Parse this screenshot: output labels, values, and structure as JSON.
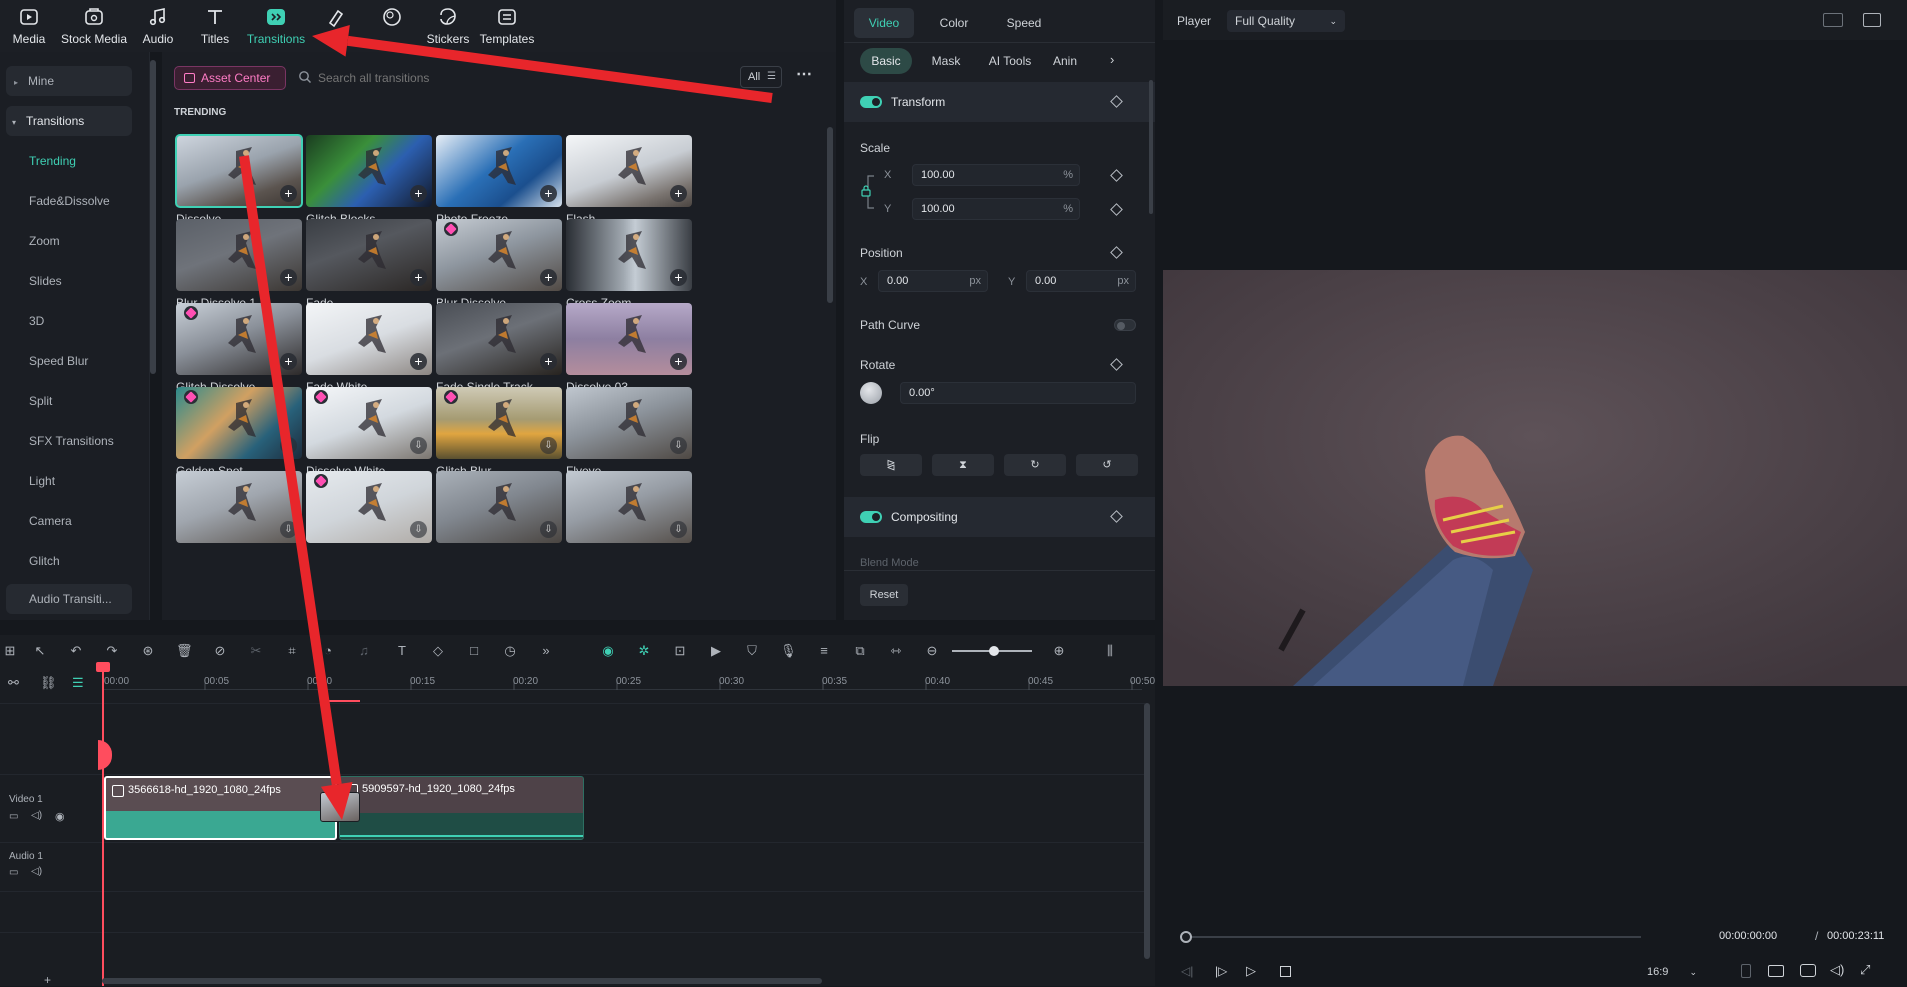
{
  "toolbar": {
    "items": [
      {
        "label": "Media",
        "icon": "media-icon"
      },
      {
        "label": "Stock Media",
        "icon": "stock-media-icon"
      },
      {
        "label": "Audio",
        "icon": "music-note-icon"
      },
      {
        "label": "Titles",
        "icon": "title-t-icon"
      },
      {
        "label": "Transitions",
        "icon": "transitions-icon",
        "active": true
      },
      {
        "label": "Effects",
        "icon": "effects-icon"
      },
      {
        "label": "Filters",
        "icon": "filters-icon"
      },
      {
        "label": "Stickers",
        "icon": "sticker-icon"
      },
      {
        "label": "Templates",
        "icon": "templates-icon"
      }
    ]
  },
  "leftnav": {
    "mine": "Mine",
    "transitions": "Transitions",
    "items": [
      "Trending",
      "Fade&Dissolve",
      "Zoom",
      "Slides",
      "3D",
      "Speed Blur",
      "Split",
      "SFX Transitions",
      "Light",
      "Camera",
      "Glitch",
      "Audio Transiti..."
    ]
  },
  "content": {
    "asset_center": "Asset Center",
    "search_placeholder": "Search all transitions",
    "filter": "All",
    "section": "TRENDING",
    "cards": [
      {
        "label": "Dissolve",
        "badge": "plus",
        "premium": false
      },
      {
        "label": "Glitch Blocks",
        "badge": "plus",
        "premium": false
      },
      {
        "label": "Photo Freeze",
        "badge": "plus",
        "premium": false
      },
      {
        "label": "Flash",
        "badge": "plus",
        "premium": false
      },
      {
        "label": "Blur Dissolve 1",
        "badge": "plus",
        "premium": false
      },
      {
        "label": "Fade",
        "badge": "plus",
        "premium": false
      },
      {
        "label": "Blur Dissolve",
        "badge": "plus",
        "premium": true
      },
      {
        "label": "Cross Zoom",
        "badge": "plus",
        "premium": false
      },
      {
        "label": "Glitch Dissolve",
        "badge": "plus",
        "premium": true
      },
      {
        "label": "Fade White",
        "badge": "plus",
        "premium": false
      },
      {
        "label": "Fade Single Track",
        "badge": "plus",
        "premium": false
      },
      {
        "label": "Dissolve 03",
        "badge": "plus",
        "premium": false
      },
      {
        "label": "Golden Spot",
        "badge": "download",
        "premium": true
      },
      {
        "label": "Dissolve White",
        "badge": "download",
        "premium": true
      },
      {
        "label": "Glitch Blur",
        "badge": "download",
        "premium": true
      },
      {
        "label": "Flyeye",
        "badge": "download",
        "premium": false
      },
      {
        "label": "",
        "badge": "download",
        "premium": false
      },
      {
        "label": "",
        "badge": "download",
        "premium": true
      },
      {
        "label": "",
        "badge": "download",
        "premium": false
      },
      {
        "label": "",
        "badge": "download",
        "premium": false
      }
    ]
  },
  "props": {
    "tabs": [
      "Video",
      "Color",
      "Speed"
    ],
    "subtabs": [
      "Basic",
      "Mask",
      "AI Tools",
      "Anin"
    ],
    "transform": "Transform",
    "scale": "Scale",
    "x_label": "X",
    "y_label": "Y",
    "scale_x": "100.00",
    "scale_y": "100.00",
    "percent": "%",
    "position": "Position",
    "pos_x": "0.00",
    "pos_y": "0.00",
    "px": "px",
    "path_curve": "Path Curve",
    "rotate": "Rotate",
    "rotate_value": "0.00°",
    "flip": "Flip",
    "compositing": "Compositing",
    "blend_mode": "Blend Mode",
    "reset": "Reset"
  },
  "player": {
    "label": "Player",
    "quality": "Full Quality",
    "current_time": "00:00:00:00",
    "separator": "/",
    "total_time": "00:00:23:11",
    "aspect": "16:9"
  },
  "timeline": {
    "ruler": [
      "00:00",
      "00:05",
      "00:10",
      "00:15",
      "00:20",
      "00:25",
      "00:30",
      "00:35",
      "00:40",
      "00:45",
      "00:50"
    ],
    "video_track": "Video 1",
    "audio_track": "Audio 1",
    "clip1": "3566618-hd_1920_1080_24fps",
    "clip2": "5909597-hd_1920_1080_24fps"
  },
  "colors": {
    "accent": "#3fd0b4",
    "annotation_arrow": "#e8262b",
    "asset_center": "#ff5bb5",
    "playhead": "#ff4d5e"
  }
}
